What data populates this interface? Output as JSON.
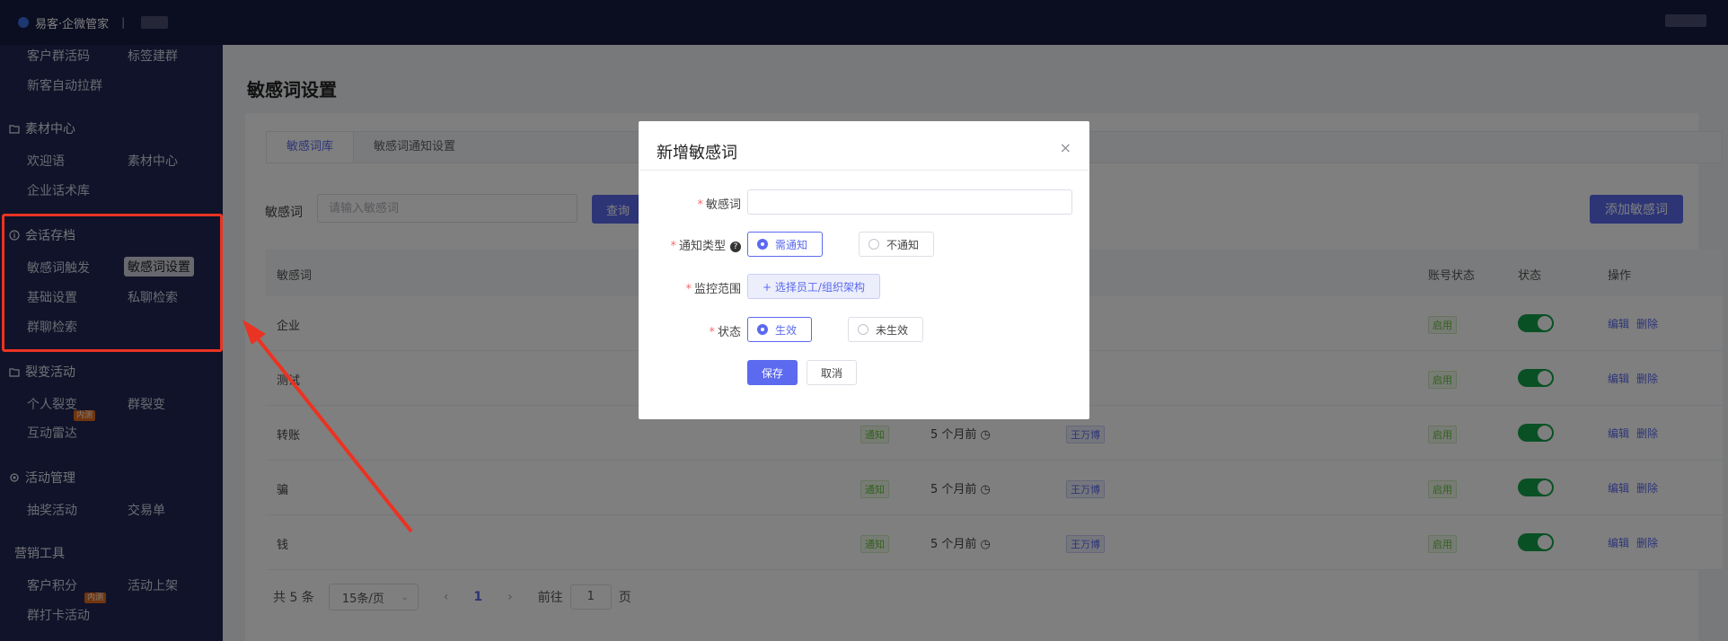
{
  "header": {
    "logo_text": "易客·企微管家",
    "separator": "|"
  },
  "sidebar": {
    "items_top": [
      "客户群活码",
      "标签建群",
      "新客自动拉群"
    ],
    "material_center": {
      "title": "素材中心",
      "items": [
        "欢迎语",
        "素材中心",
        "企业话术库"
      ]
    },
    "session_archive": {
      "title": "会话存档",
      "items": [
        "敏感词触发",
        "敏感词设置",
        "基础设置",
        "私聊检索",
        "群聊检索"
      ]
    },
    "fission": {
      "title": "裂变活动",
      "items": [
        "个人裂变",
        "群裂变",
        "互动雷达"
      ],
      "badge": "内测"
    },
    "activity_mgmt": {
      "title": "活动管理",
      "items": [
        "抽奖活动",
        "交易单"
      ]
    },
    "marketing_tools": {
      "title": "营销工具",
      "items": [
        "客户积分",
        "活动上架",
        "群打卡活动"
      ],
      "badge": "内测"
    }
  },
  "main": {
    "page_title": "敏感词设置",
    "tabs": [
      "敏感词库",
      "敏感词通知设置"
    ],
    "filter": {
      "label": "敏感词",
      "placeholder": "请输入敏感词",
      "query_button": "查询"
    },
    "add_button": "添加敏感词",
    "table": {
      "headers": {
        "word": "敏感词",
        "account_status": "账号状态",
        "status": "状态",
        "actions": "操作"
      },
      "rows": [
        {
          "word": "企业",
          "notify": "",
          "time": "",
          "owner": "",
          "account_status": "启用"
        },
        {
          "word": "测试",
          "notify": "",
          "time": "",
          "owner": "",
          "account_status": "启用"
        },
        {
          "word": "转账",
          "notify": "通知",
          "time": "5 个月前",
          "owner": "王万博",
          "account_status": "启用"
        },
        {
          "word": "骗",
          "notify": "通知",
          "time": "5 个月前",
          "owner": "王万博",
          "account_status": "启用"
        },
        {
          "word": "钱",
          "notify": "通知",
          "time": "5 个月前",
          "owner": "王万博",
          "account_status": "启用"
        }
      ],
      "action_edit": "编辑",
      "action_delete": "删除"
    },
    "pagination": {
      "total": "共 5 条",
      "page_size": "15条/页",
      "current_page": "1",
      "goto_prefix": "前往",
      "goto_value": "1",
      "goto_suffix": "页"
    }
  },
  "modal": {
    "title": "新增敏感词",
    "close": "×",
    "fields": {
      "word_label": "敏感词",
      "notify_type_label": "通知类型",
      "notify_options": [
        "需通知",
        "不通知"
      ],
      "scope_label": "监控范围",
      "scope_button": "+ 选择员工/组织架构",
      "status_label": "状态",
      "status_options": [
        "生效",
        "未生效"
      ]
    },
    "save": "保存",
    "cancel": "取消"
  },
  "colors": {
    "primary": "#5b6aef",
    "sidebar_bg": "#212652",
    "topbar_bg": "#161a42",
    "switch_on": "#13a24b",
    "annotation": "#ea3323"
  }
}
